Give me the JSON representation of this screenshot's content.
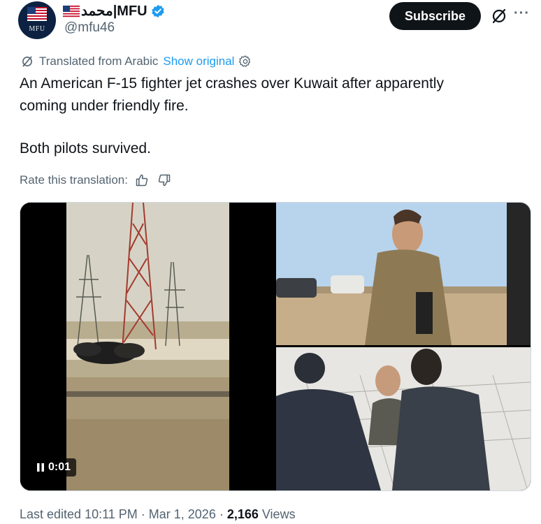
{
  "author": {
    "avatar_label": "MFU",
    "display_name": "محمد|MFU",
    "handle": "@mfu46",
    "verified_color": "#1d9bf0"
  },
  "header_actions": {
    "subscribe_label": "Subscribe",
    "grok_icon": "grok-icon",
    "more_label": "···"
  },
  "translation": {
    "note": "Translated from Arabic",
    "show_original": "Show original",
    "settings_icon": "gear-icon"
  },
  "tweet": {
    "line1": "An American F-15 fighter jet crashes over Kuwait after apparently",
    "line2": "coming under friendly fire.",
    "line3": "Both pilots survived."
  },
  "rating": {
    "label": "Rate this translation:",
    "up_icon": "thumbs-up-icon",
    "down_icon": "thumbs-down-icon"
  },
  "media": {
    "video_time": "0:01",
    "pause_icon": "pause-icon"
  },
  "footer": {
    "edited": "Last edited 10:11 PM · Mar 1, 2026 · ",
    "views_count": "2,166",
    "views_label": " Views"
  },
  "colors": {
    "text": "#0f1419",
    "secondary": "#536471",
    "link": "#1d9bf0"
  }
}
